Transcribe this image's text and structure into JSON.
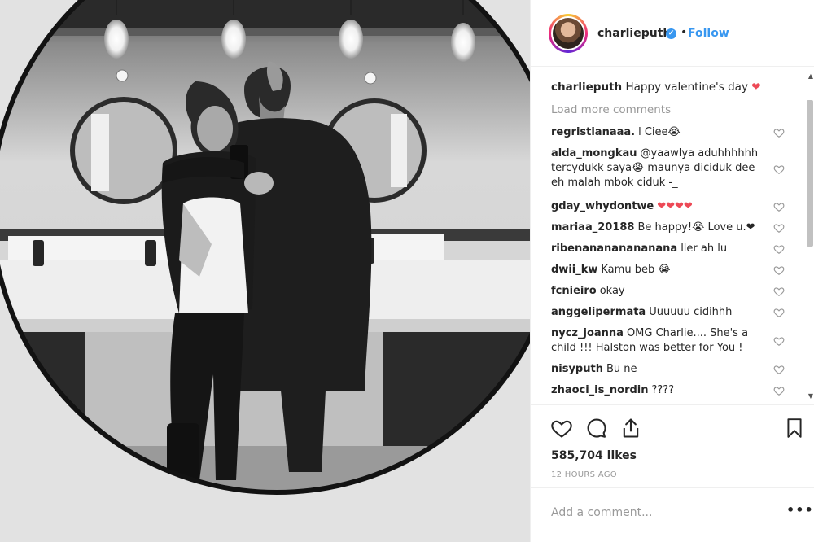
{
  "post": {
    "author": "charlieputh",
    "verified_mark": "✔",
    "separator": "•",
    "follow_label": "Follow",
    "caption_user": "charlieputh",
    "caption_text": "Happy valentine's day",
    "caption_emoji": "❤",
    "load_more": "Load more comments",
    "likes": "585,704 likes",
    "time_ago": "12 HOURS AGO",
    "add_comment_placeholder": "Add a comment...",
    "more_label": "•••"
  },
  "comments": [
    {
      "user": "regristianaaa.",
      "text": "l Ciee😭"
    },
    {
      "user": "alda_mongkau",
      "text": "@yaawlya aduhhhhhh tercydukk saya😭 maunya diciduk dee eh malah mbok ciduk -_"
    },
    {
      "user": "gday_whydontwe",
      "text": "❤❤❤❤"
    },
    {
      "user": "mariaa_20188",
      "text": "Be happy!😭 Love u.❤"
    },
    {
      "user": "ribenanananananana",
      "text": "ller ah lu"
    },
    {
      "user": "dwii_kw",
      "text": "Kamu beb 😭"
    },
    {
      "user": "fcnieiro",
      "text": "okay"
    },
    {
      "user": "anggelipermata",
      "text": "Uuuuuu cidihhh"
    },
    {
      "user": "nycz_joanna",
      "text": "OMG Charlie.... She's a child !!! Halston was better for You !"
    },
    {
      "user": "nisyputh",
      "text": "Bu ne"
    },
    {
      "user": "zhaoci_is_nordin",
      "text": "????"
    }
  ],
  "icons": {
    "like": "heart-icon",
    "comment": "comment-icon",
    "share": "share-icon",
    "save": "bookmark-icon",
    "comment_like": "heart-icon"
  },
  "colors": {
    "accent": "#3897f0",
    "heart": "#ed4956",
    "muted": "#999999",
    "text": "#262626"
  }
}
